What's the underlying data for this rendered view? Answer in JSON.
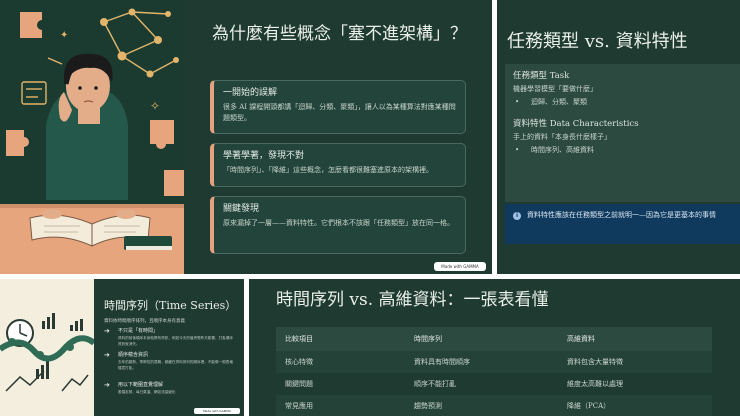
{
  "slide1": {
    "title": "為什麼有些概念「塞不進架構」？",
    "cards": [
      {
        "heading": "一開始的誤解",
        "body": "很多 AI 課程開頭都講「迴歸、分類、聚類」，讓人以為某種算法對應某種問題類型。"
      },
      {
        "heading": "學著學著，發現不對",
        "body": "「時間序列」、「降維」這些概念，怎麼看都很難塞進原本的架構裡。"
      },
      {
        "heading": "關鍵發現",
        "body": "原來漏掉了一層——資料特性。它們根本不該跟「任務類型」放在同一格。"
      }
    ],
    "badge": "Made with GAMMA",
    "colors": {
      "accent": "#e5a27f",
      "background": "#1f3a31"
    }
  },
  "slide2": {
    "title": "任務類型 vs. 資料特性",
    "task_heading": "任務類型 Task",
    "task_desc": "機器學習模型「要做什麼」",
    "task_items": [
      "迴歸、分類、聚類"
    ],
    "data_heading": "資料特性 Data Characteristics",
    "data_desc": "手上的資料「本身長什麼樣子」",
    "data_items": [
      "時間序列、高維資料"
    ],
    "info": "資料特性應該在任務類型之前就明一—因為它是更基本的事情",
    "bullet": "•",
    "info_icon": "i",
    "colors": {
      "info_bg": "#0f3a5d"
    }
  },
  "slide3": {
    "title": "時間序列（Time Series）",
    "subtitle": "資料依時間順序排列，且順序本身有意義",
    "items": [
      {
        "heading": "不只是「有時間」",
        "body": "資料的前後順序本身就帶有資訊，例如今天的值會受昨天影響，打亂順序資訊就消失。"
      },
      {
        "heading": "順序蘊含資訊",
        "body": "去年的趨勢、季節性的週期，都藏在資料排列的順序裡，不能像一般表格隨意打亂。"
      },
      {
        "heading": "用以下範圍直覺理解",
        "body": "股價走勢、每日氣溫、網站流量變化"
      }
    ],
    "arrow": "➔",
    "badge": "Made with GAMMA"
  },
  "slide4": {
    "title": "時間序列 vs. 高維資料：一張表看懂",
    "table": {
      "headers": [
        "比較項目",
        "時間序列",
        "高維資料"
      ],
      "rows": [
        [
          "核心特徵",
          "資料具有時間順序",
          "資料包含大量特徵"
        ],
        [
          "關鍵問題",
          "順序不能打亂",
          "維度太高難以處理"
        ],
        [
          "常見應用",
          "趨勢預測",
          "降維（PCA）"
        ]
      ]
    }
  }
}
